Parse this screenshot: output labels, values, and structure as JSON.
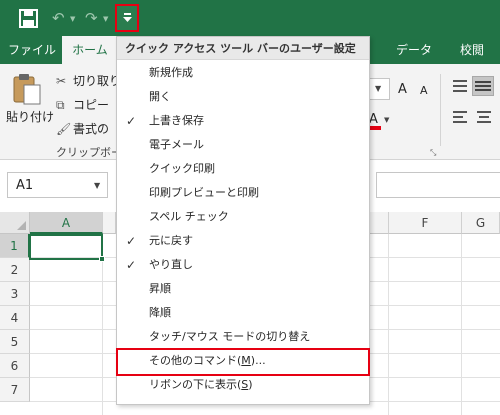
{
  "quick_access": {
    "save_icon": "save-icon",
    "undo_icon": "undo-icon",
    "redo_icon": "redo-icon",
    "customize_icon": "customize-qat-dropdown-icon",
    "accent": "#217346",
    "highlight": "#e60012"
  },
  "tabs": [
    {
      "label": "ファイル"
    },
    {
      "label": "ホーム"
    },
    {
      "label": "データ"
    },
    {
      "label": "校閲"
    }
  ],
  "ribbon": {
    "paste_label": "貼り付け",
    "cut_label": "切り取り",
    "copy_label": "コピー",
    "format_painter_label": "書式の",
    "clipboard_group_label": "クリップボー",
    "font_size_value": "",
    "grow_font": "A",
    "shrink_font": "A",
    "font_color": "A"
  },
  "formula_bar": {
    "name_box": "A1"
  },
  "grid": {
    "columns": [
      "A",
      "F",
      "G"
    ],
    "rows": [
      "1",
      "2",
      "3",
      "4",
      "5",
      "6",
      "7"
    ],
    "active_cell": "A1"
  },
  "menu": {
    "header": "クイック アクセス ツール バーのユーザー設定",
    "items": [
      {
        "label": "新規作成",
        "checked": false
      },
      {
        "label": "開く",
        "checked": false
      },
      {
        "label": "上書き保存",
        "checked": true
      },
      {
        "label": "電子メール",
        "checked": false
      },
      {
        "label": "クイック印刷",
        "checked": false
      },
      {
        "label": "印刷プレビューと印刷",
        "checked": false
      },
      {
        "label": "スペル チェック",
        "checked": false
      },
      {
        "label": "元に戻す",
        "checked": true
      },
      {
        "label": "やり直し",
        "checked": true
      },
      {
        "label": "昇順",
        "checked": false
      },
      {
        "label": "降順",
        "checked": false
      },
      {
        "label": "タッチ/マウス モードの切り替え",
        "checked": false
      },
      {
        "label_pre": "その他のコマンド(",
        "label_key": "M",
        "label_post": ")...",
        "checked": false
      },
      {
        "label_pre": "リボンの下に表示(",
        "label_key": "S",
        "label_post": ")",
        "checked": false
      }
    ],
    "check_glyph": "✓"
  }
}
